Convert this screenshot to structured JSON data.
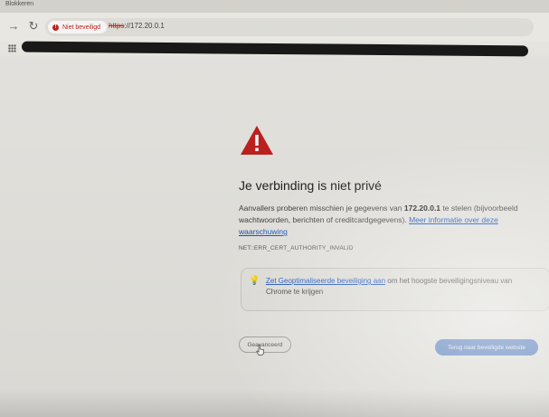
{
  "window": {
    "top_label": "Blokkeren"
  },
  "toolbar": {
    "security_badge": "Niet beveiligd",
    "url_scheme": "https",
    "url_rest": "://172.20.0.1"
  },
  "page": {
    "title": "Je verbinding is niet privé",
    "body_part1": "Aanvallers proberen misschien je gegevens van ",
    "host": "172.20.0.1",
    "body_part2": " te stelen (bijvoorbeeld wachtwoorden, berichten of creditcardgegevens). ",
    "learn_more_link": "Meer informatie over deze waarschuwing",
    "error_code": "NET::ERR_CERT_AUTHORITY_INVALID",
    "tip_link": "Zet Geoptimaliseerde beveiliging aan",
    "tip_text": " om het hoogste beveiligingsniveau van Chrome te krijgen",
    "advanced_button": "Geavanceerd",
    "back_button": "Terug naar beveiligde website"
  },
  "icons": {
    "back": "arrow-left-icon",
    "reload": "reload-icon",
    "warning": "warning-triangle-icon",
    "tip": "lightbulb-icon",
    "apps": "apps-grid-icon"
  },
  "colors": {
    "warning_red": "#c5221f",
    "link_blue": "#1a56c5",
    "primary_button": "#5e87c8"
  }
}
